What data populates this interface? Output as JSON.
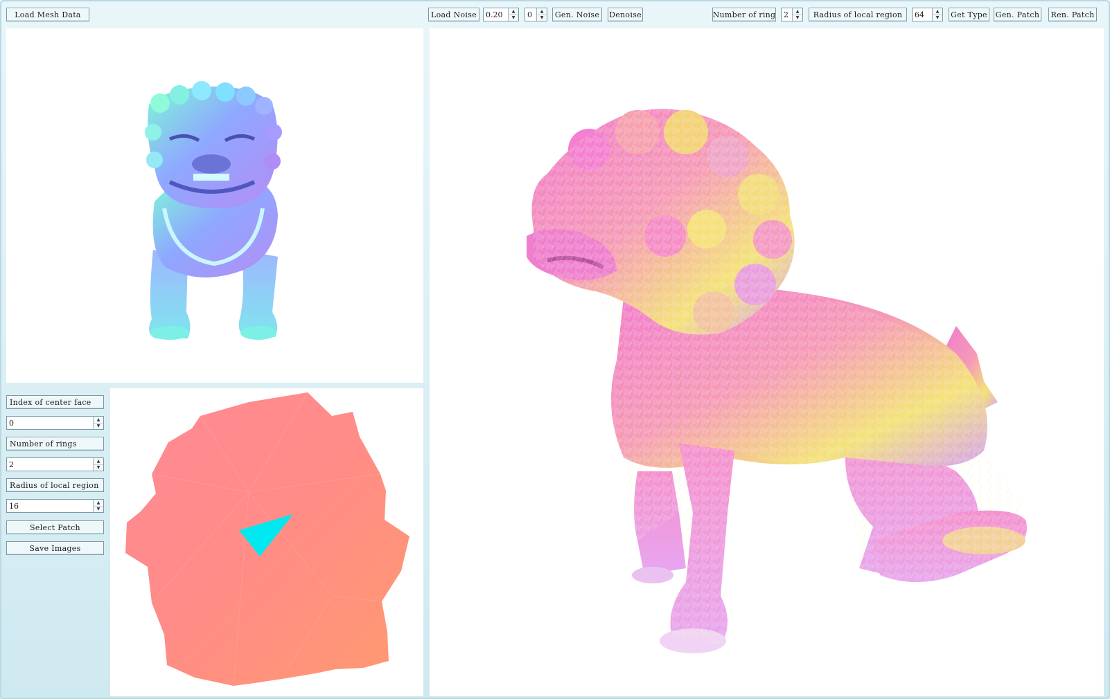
{
  "toolbar": {
    "load_mesh": "Load Mesh Data",
    "load_noise": "Load Noise",
    "noise_level": "0.20",
    "noise_type": "0",
    "gen_noise": "Gen. Noise",
    "denoise": "Denoise",
    "number_of_ring_label": "Number of ring",
    "number_of_ring_value": "2",
    "radius_label": "Radius of local region",
    "radius_value": "64",
    "get_type": "Get Type",
    "gen_patch": "Gen. Patch",
    "ren_patch": "Ren. Patch"
  },
  "side_panel": {
    "center_face_label": "Index of center face",
    "center_face_value": "0",
    "rings_label": "Number of rings",
    "rings_value": "2",
    "radius_label": "Radius of local region",
    "radius_value": "16",
    "select_patch": "Select Patch",
    "save_images": "Save Images"
  },
  "colors": {
    "panel_bg": "#d6eef4",
    "button_bg": "#eef8fb",
    "original_mesh": "#8fa8ff",
    "noisy_mesh": "#f490cf",
    "patch_face": "#ff8c86",
    "center_face": "#00e8f0"
  }
}
